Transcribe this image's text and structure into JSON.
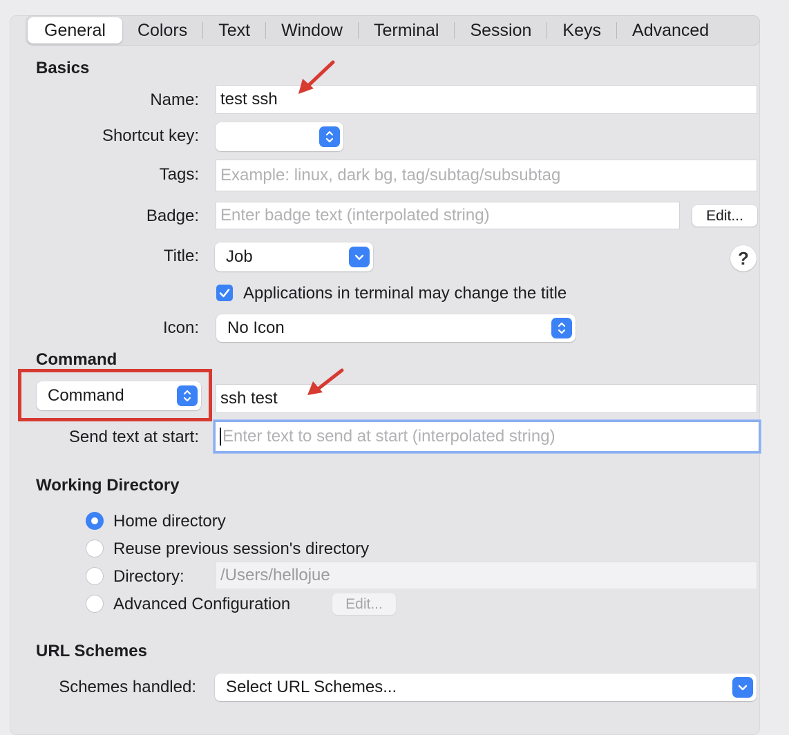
{
  "tabs": [
    "General",
    "Colors",
    "Text",
    "Window",
    "Terminal",
    "Session",
    "Keys",
    "Advanced"
  ],
  "basics": {
    "heading": "Basics",
    "name_label": "Name:",
    "name_value": "test ssh",
    "shortcut_label": "Shortcut key:",
    "shortcut_value": "",
    "tags_label": "Tags:",
    "tags_placeholder": "Example: linux, dark bg, tag/subtag/subsubtag",
    "badge_label": "Badge:",
    "badge_placeholder": "Enter badge text (interpolated string)",
    "badge_edit": "Edit...",
    "title_label": "Title:",
    "title_value": "Job",
    "help": "?",
    "apps_change_title": "Applications in terminal may change the title",
    "apps_change_title_checked": true,
    "icon_label": "Icon:",
    "icon_value": "No Icon"
  },
  "command": {
    "heading": "Command",
    "type_value": "Command",
    "command_value": "ssh test",
    "send_text_label": "Send text at start:",
    "send_text_placeholder": "Enter text to send at start (interpolated string)"
  },
  "working_directory": {
    "heading": "Working Directory",
    "options": [
      "Home directory",
      "Reuse previous session's directory",
      "Directory:",
      "Advanced Configuration"
    ],
    "selected": "Home directory",
    "directory_placeholder": "/Users/hellojue",
    "advanced_edit": "Edit..."
  },
  "url_schemes": {
    "heading": "URL Schemes",
    "schemes_label": "Schemes handled:",
    "schemes_value": "Select URL Schemes..."
  },
  "colors": {
    "accent": "#3b82f6",
    "annotation_red": "#d63a31"
  }
}
